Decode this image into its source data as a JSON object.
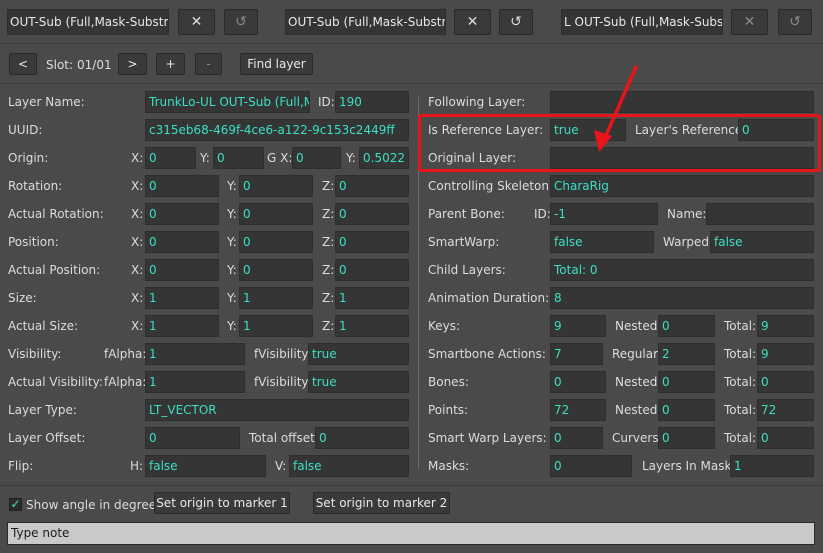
{
  "tabs": [
    {
      "title": "OUT-Sub (Full,Mask-Substract",
      "close": "✕",
      "reset": "↺"
    },
    {
      "title": "OUT-Sub (Full,Mask-Substract",
      "close": "✕",
      "reset": "↺"
    },
    {
      "title": "L OUT-Sub (Full,Mask-Substrac",
      "close": "✕",
      "reset": "↺"
    }
  ],
  "slot_bar": {
    "prev": "<",
    "slot_label": "Slot:",
    "slot_value": "01/01",
    "next": ">",
    "plus": "+",
    "minus": "-",
    "find": "Find layer"
  },
  "left": {
    "layer_name_label": "Layer Name:",
    "layer_name": "TrunkLo-UL OUT-Sub (Full,Ma",
    "id_label": "ID:",
    "id": "190",
    "uuid_label": "UUID:",
    "uuid": "c315eb68-469f-4ce6-a122-9c153c2449ff",
    "origin_label": "Origin:",
    "origin_x_label": "X:",
    "origin_x": "0",
    "origin_y_label": "Y:",
    "origin_y": "0",
    "origin_gx_label": "G X:",
    "origin_gx": "0",
    "origin_gy_label": "Y:",
    "origin_gy": "0.5022",
    "rotation_label": "Rotation:",
    "rot_x": "0",
    "rot_y": "0",
    "rot_z": "0",
    "actual_rotation_label": "Actual Rotation:",
    "arot_x": "0",
    "arot_y": "0",
    "arot_z": "0",
    "position_label": "Position:",
    "pos_x": "0",
    "pos_y": "0",
    "pos_z": "0",
    "actual_position_label": "Actual Position:",
    "apos_x": "0",
    "apos_y": "0",
    "apos_z": "0",
    "size_label": "Size:",
    "size_x": "1",
    "size_y": "1",
    "size_z": "1",
    "actual_size_label": "Actual Size:",
    "asize_x": "1",
    "asize_y": "1",
    "asize_z": "1",
    "x_label": "X:",
    "y_label": "Y:",
    "z_label": "Z:",
    "visibility_label": "Visibility:",
    "falpha_label": "fAlpha:",
    "falpha": "1",
    "fvisibility_label": "fVisibility:",
    "fvisibility": "true",
    "actual_visibility_label": "Actual Visibility:",
    "afalpha": "1",
    "afvisibility": "true",
    "layer_type_label": "Layer Type:",
    "layer_type": "LT_VECTOR",
    "layer_offset_label": "Layer Offset:",
    "layer_offset": "0",
    "total_offset_label": "Total offset:",
    "total_offset": "0",
    "flip_label": "Flip:",
    "flip_h_label": "H:",
    "flip_h": "false",
    "flip_v_label": "V:",
    "flip_v": "false"
  },
  "right": {
    "following_layer_label": "Following Layer:",
    "following_layer": "",
    "is_reference_label": "Is Reference Layer:",
    "is_reference": "true",
    "layer_refs_label": "Layer's References:",
    "layer_refs": "0",
    "original_layer_label": "Original Layer:",
    "original_layer": "",
    "controlling_skeleton_label": "Controlling Skeleton:",
    "controlling_skeleton": "CharaRig",
    "parent_bone_label": "Parent Bone:",
    "parent_bone_id_label": "ID:",
    "parent_bone_id": "-1",
    "parent_bone_name_label": "Name:",
    "parent_bone_name": "",
    "smartwarp_label": "SmartWarp:",
    "smartwarp": "false",
    "warped_label": "Warped:",
    "warped": "false",
    "child_layers_label": "Child Layers:",
    "child_layers": "Total: 0",
    "anim_duration_label": "Animation Duration:",
    "anim_duration": "8",
    "keys_label": "Keys:",
    "keys": "9",
    "nested_label": "Nested:",
    "keys_nested": "0",
    "total_label": "Total:",
    "keys_total": "9",
    "sb_actions_label": "Smartbone Actions:",
    "sb_actions": "7",
    "regular_label": "Regular:",
    "sb_regular": "2",
    "sb_total": "9",
    "bones_label": "Bones:",
    "bones": "0",
    "bones_nested": "0",
    "bones_total": "0",
    "points_label": "Points:",
    "points": "72",
    "points_nested": "0",
    "points_total": "72",
    "sw_layers_label": "Smart Warp Layers:",
    "sw_layers": "0",
    "curvers_label": "Curvers:",
    "curvers": "0",
    "sw_total": "0",
    "masks_label": "Masks:",
    "masks": "0",
    "layers_in_masks_label": "Layers In Masks:",
    "layers_in_masks": "1"
  },
  "bottom": {
    "show_angle_check": "✓",
    "show_angle_label": "Show angle in degrees",
    "origin_m1": "Set origin to marker 1",
    "origin_m2": "Set origin to marker 2",
    "note_placeholder": "Type note"
  },
  "colors": {
    "value_text": "#39e0c4",
    "highlight": "#e8141b",
    "panel_bg": "#4a4a4a",
    "field_bg": "#353535"
  }
}
